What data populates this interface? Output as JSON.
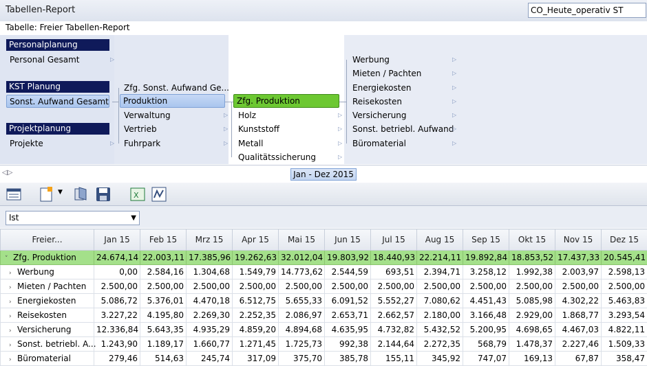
{
  "window": {
    "title": "Tabellen-Report",
    "context": "CO_Heute_operativ ST"
  },
  "subtitle": "Tabelle: Freier Tabellen-Report",
  "tree": {
    "col1": [
      {
        "header": "Personalplanung",
        "item": "Personal Gesamt"
      },
      {
        "header": "KST Planung",
        "item": "Sonst. Aufwand Gesamt"
      },
      {
        "header": "Projektplanung",
        "item": "Projekte"
      }
    ],
    "col2": [
      "Zfg. Sonst. Aufwand Ge...",
      "Produktion",
      "Verwaltung",
      "Vertrieb",
      "Fuhrpark"
    ],
    "col3": [
      "Zfg. Produktion",
      "Holz",
      "Kunststoff",
      "Metall",
      "Qualitätssicherung"
    ],
    "col4": [
      "Werbung",
      "Mieten / Pachten",
      "Energiekosten",
      "Reisekosten",
      "Versicherung",
      "Sonst. betriebl. Aufwand",
      "Büromaterial"
    ]
  },
  "timeline": {
    "period": "Jan - Dez 2015"
  },
  "filter": {
    "value": "Ist"
  },
  "table": {
    "header_first": "Freier...",
    "months": [
      "Jan 15",
      "Feb 15",
      "Mrz 15",
      "Apr 15",
      "Mai 15",
      "Jun 15",
      "Jul 15",
      "Aug 15",
      "Sep 15",
      "Okt 15",
      "Nov 15",
      "Dez 15"
    ],
    "rows": [
      {
        "label": "Zfg. Produktion",
        "values": [
          "24.674,14",
          "22.003,11",
          "17.385,96",
          "19.262,63",
          "32.012,04",
          "19.803,92",
          "18.440,93",
          "22.214,11",
          "19.892,84",
          "18.853,52",
          "17.437,33",
          "20.545,41"
        ]
      },
      {
        "label": "Werbung",
        "values": [
          "0,00",
          "2.584,16",
          "1.304,68",
          "1.549,79",
          "14.773,62",
          "2.544,59",
          "693,51",
          "2.394,71",
          "3.258,12",
          "1.992,38",
          "2.003,97",
          "2.598,13"
        ]
      },
      {
        "label": "Mieten / Pachten",
        "values": [
          "2.500,00",
          "2.500,00",
          "2.500,00",
          "2.500,00",
          "2.500,00",
          "2.500,00",
          "2.500,00",
          "2.500,00",
          "2.500,00",
          "2.500,00",
          "2.500,00",
          "2.500,00"
        ]
      },
      {
        "label": "Energiekosten",
        "values": [
          "5.086,72",
          "5.376,01",
          "4.470,18",
          "6.512,75",
          "5.655,33",
          "6.091,52",
          "5.552,27",
          "7.080,62",
          "4.451,43",
          "5.085,98",
          "4.302,22",
          "5.463,83"
        ]
      },
      {
        "label": "Reisekosten",
        "values": [
          "3.227,22",
          "4.195,80",
          "2.269,30",
          "2.252,35",
          "2.086,97",
          "2.653,71",
          "2.662,57",
          "2.180,00",
          "3.166,48",
          "2.929,00",
          "1.868,77",
          "3.293,54"
        ]
      },
      {
        "label": "Versicherung",
        "values": [
          "12.336,84",
          "5.643,35",
          "4.935,29",
          "4.859,20",
          "4.894,68",
          "4.635,95",
          "4.732,82",
          "5.432,52",
          "5.200,95",
          "4.698,65",
          "4.467,03",
          "4.822,11"
        ]
      },
      {
        "label": "Sonst. betriebl. A...",
        "values": [
          "1.243,90",
          "1.189,17",
          "1.660,77",
          "1.271,45",
          "1.725,73",
          "992,38",
          "2.144,64",
          "2.272,35",
          "568,79",
          "1.478,37",
          "2.227,46",
          "1.509,33"
        ]
      },
      {
        "label": "Büromaterial",
        "values": [
          "279,46",
          "514,63",
          "245,74",
          "317,09",
          "375,70",
          "385,78",
          "155,11",
          "345,92",
          "747,07",
          "169,13",
          "67,87",
          "358,47"
        ]
      }
    ]
  }
}
